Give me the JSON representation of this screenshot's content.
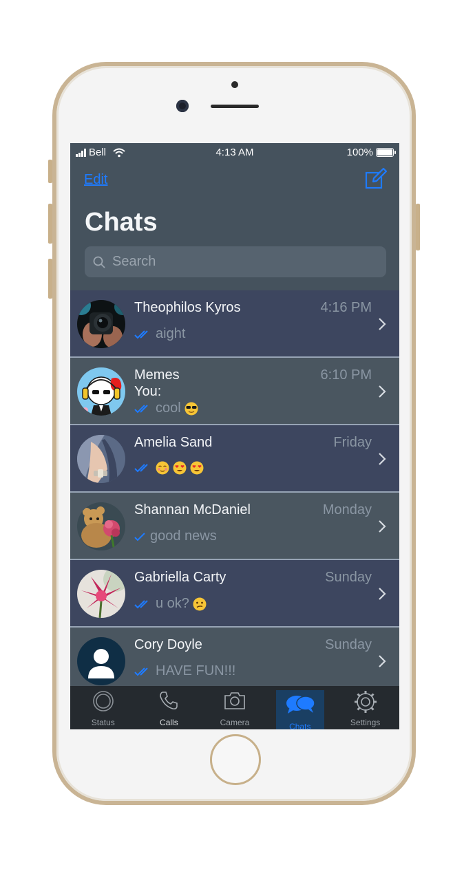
{
  "status_bar": {
    "carrier": "Bell",
    "time": "4:13 AM",
    "battery": "100%"
  },
  "nav": {
    "edit_label": "Edit",
    "title": "Chats",
    "search_placeholder": "Search"
  },
  "chats": [
    {
      "name": "Theophilos Kyros",
      "time": "4:16 PM",
      "preview": "aight",
      "ticks": "double"
    },
    {
      "name": "Memes",
      "time": "6:10 PM",
      "sender": "You:",
      "preview": "cool",
      "ticks": "double",
      "emoji": "sunglasses"
    },
    {
      "name": "Amelia Sand",
      "time": "Friday",
      "preview": "",
      "ticks": "double",
      "emoji": "blush, heart-eyes, heart-eyes"
    },
    {
      "name": "Shannan McDaniel",
      "time": "Monday",
      "preview": "good news",
      "ticks": "single"
    },
    {
      "name": "Gabriella Carty",
      "time": "Sunday",
      "preview": "u ok?",
      "ticks": "double",
      "emoji": "confused"
    },
    {
      "name": "Cory Doyle",
      "time": "Sunday",
      "preview": "HAVE FUN!!!",
      "ticks": "double"
    }
  ],
  "tabs": [
    {
      "label": "Status",
      "icon": "status-icon",
      "active": false
    },
    {
      "label": "Calls",
      "icon": "phone-icon",
      "active": false
    },
    {
      "label": "Camera",
      "icon": "camera-icon",
      "active": false
    },
    {
      "label": "Chats",
      "icon": "chat-bubbles-icon",
      "active": true
    },
    {
      "label": "Settings",
      "icon": "gear-icon",
      "active": false
    }
  ],
  "colors": {
    "accent": "#1e7bff",
    "header_bg": "#45525d",
    "row_dark": "#3d465f",
    "row_light": "#4a5660",
    "tab_bg": "#252a2f",
    "phone_gold": "#c9b494"
  }
}
